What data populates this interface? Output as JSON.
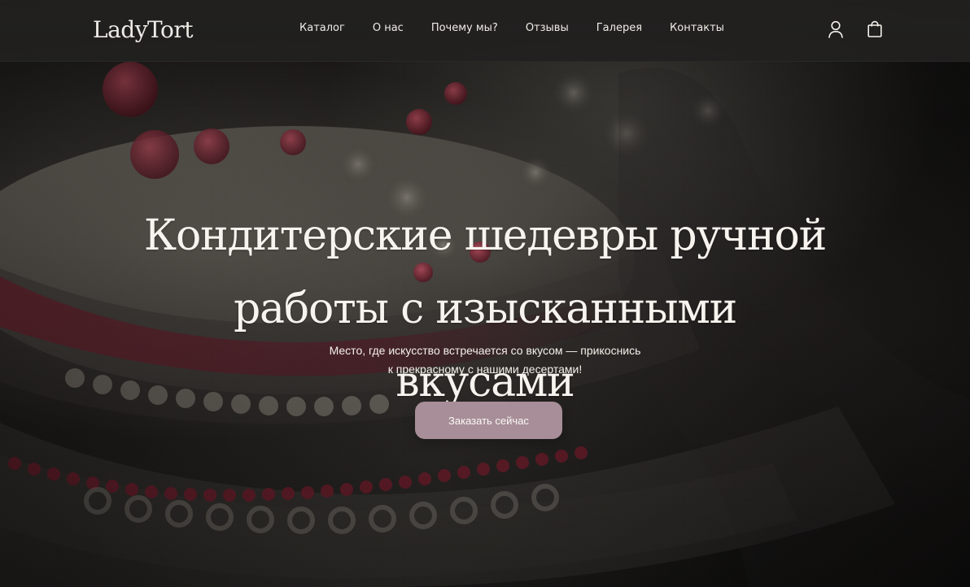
{
  "header": {
    "logo_text": "LadyTort",
    "nav": [
      {
        "label": "Каталог"
      },
      {
        "label": "О нас"
      },
      {
        "label": "Почему мы?"
      },
      {
        "label": "Отзывы"
      },
      {
        "label": "Галерея"
      },
      {
        "label": "Контакты"
      }
    ],
    "icons": {
      "account": "user-icon",
      "cart": "shopping-bag-icon"
    }
  },
  "hero": {
    "title_line_1": "Кондитерские шедевры ручной",
    "title_line_2": "работы с изысканными вкусами",
    "subtitle_line_1": "Место, где искусство встречается со вкусом — прикоснись",
    "subtitle_line_2": "к прекрасному с нашими десертами!",
    "cta_label": "Заказать сейчас"
  },
  "colors": {
    "header_bg": "#21201f",
    "cta_bg": "#a78e98",
    "text": "#f3efe9",
    "accent_red": "#6e1f2b"
  }
}
